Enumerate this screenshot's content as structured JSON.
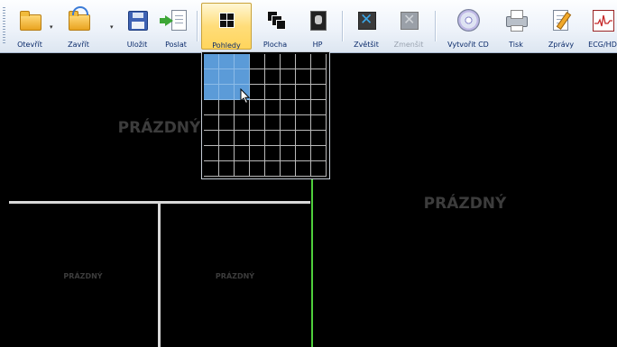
{
  "toolbar": {
    "buttons": [
      {
        "id": "open",
        "label": "Otevřít"
      },
      {
        "id": "close",
        "label": "Zavřít"
      },
      {
        "id": "save",
        "label": "Uložit"
      },
      {
        "id": "send",
        "label": "Poslat"
      },
      {
        "id": "views",
        "label": "Pohledy"
      },
      {
        "id": "desktop",
        "label": "Plocha"
      },
      {
        "id": "hp",
        "label": "HP"
      },
      {
        "id": "enlarge",
        "label": "Zvětšit"
      },
      {
        "id": "shrink",
        "label": "Zmenšit"
      },
      {
        "id": "create_cd",
        "label": "Vytvořit CD"
      },
      {
        "id": "print",
        "label": "Tisk"
      },
      {
        "id": "reports",
        "label": "Zprávy"
      },
      {
        "id": "ecg",
        "label": "ECG/HD"
      }
    ],
    "active_button": "Pohledy",
    "disabled_buttons": [
      "Zmenšit"
    ]
  },
  "viewer": {
    "panes": [
      {
        "label": "PRÁZDNÝ"
      },
      {
        "label": "PRÁZDNÝ"
      },
      {
        "label": "PRÁZDNÝ"
      },
      {
        "label": "PRÁZDNÝ"
      }
    ]
  },
  "layout_picker": {
    "columns": 8,
    "rows": 8,
    "selected_columns": 3,
    "selected_rows": 3
  },
  "colors": {
    "selection": "#5b9bd8",
    "active_pane_border": "#4fcf3c",
    "pane_background": "#000000",
    "empty_label": "#3c3c3c"
  }
}
